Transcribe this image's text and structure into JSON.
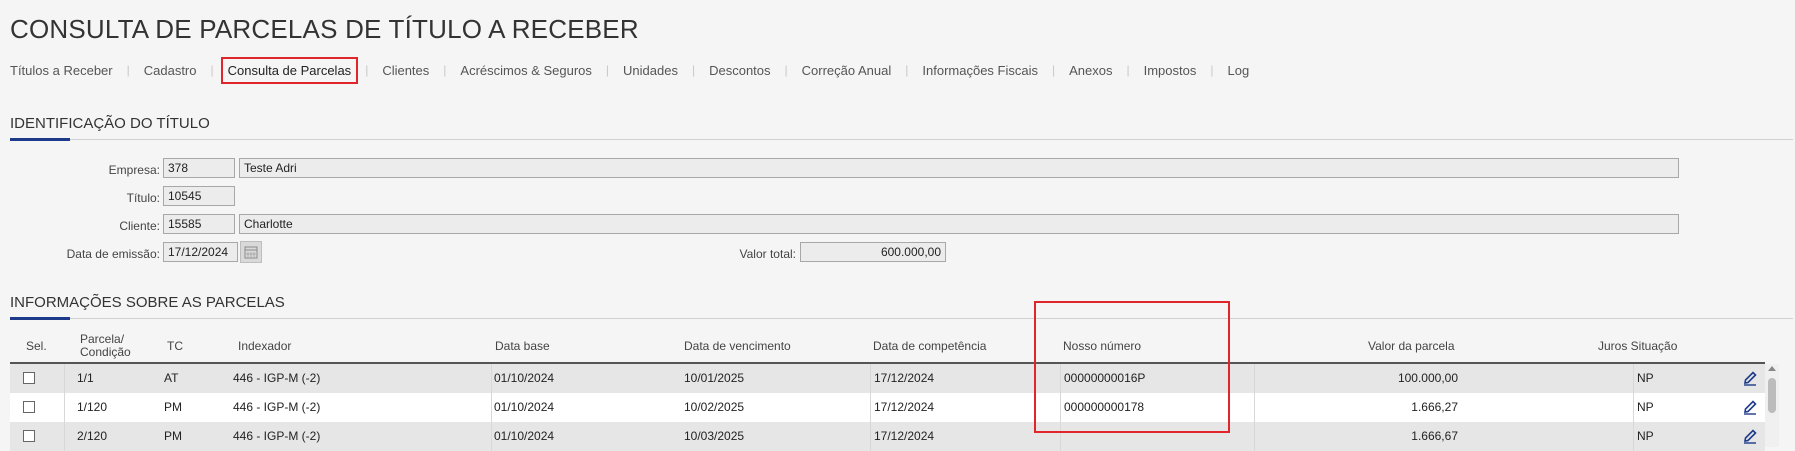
{
  "page_title": "CONSULTA DE PARCELAS DE TÍTULO A RECEBER",
  "tabs": [
    {
      "label": "Títulos a Receber"
    },
    {
      "label": "Cadastro"
    },
    {
      "label": "Consulta de Parcelas",
      "active": true
    },
    {
      "label": "Clientes"
    },
    {
      "label": "Acréscimos & Seguros"
    },
    {
      "label": "Unidades"
    },
    {
      "label": "Descontos"
    },
    {
      "label": "Correção Anual"
    },
    {
      "label": "Informações Fiscais"
    },
    {
      "label": "Anexos"
    },
    {
      "label": "Impostos"
    },
    {
      "label": "Log"
    }
  ],
  "identificacao": {
    "title": "IDENTIFICAÇÃO DO TÍTULO",
    "empresa_label": "Empresa:",
    "empresa_code": "378",
    "empresa_name": "Teste Adri",
    "titulo_label": "Título:",
    "titulo_value": "10545",
    "cliente_label": "Cliente:",
    "cliente_code": "15585",
    "cliente_name": "Charlotte",
    "data_emissao_label": "Data de emissão:",
    "data_emissao_value": "17/12/2024",
    "valor_total_label": "Valor total:",
    "valor_total_value": "600.000,00"
  },
  "parcelas": {
    "title": "INFORMAÇÕES SOBRE AS PARCELAS",
    "headers": {
      "sel": "Sel.",
      "parcela_line1": "Parcela/",
      "parcela_line2": "Condição",
      "tc": "TC",
      "indexador": "Indexador",
      "data_base": "Data base",
      "data_vencimento": "Data de vencimento",
      "data_competencia": "Data de competência",
      "nosso_numero": "Nosso número",
      "valor_parcela": "Valor da parcela",
      "juros_situacao": "Juros Situação"
    },
    "rows": [
      {
        "parcela": "1/1",
        "tc": "AT",
        "indexador": "446 - IGP-M (-2)",
        "data_base": "01/10/2024",
        "vencimento": "10/01/2025",
        "competencia": "17/12/2024",
        "nosso_numero": "00000000016P",
        "valor": "100.000,00",
        "situacao": "NP"
      },
      {
        "parcela": "1/120",
        "tc": "PM",
        "indexador": "446 - IGP-M (-2)",
        "data_base": "01/10/2024",
        "vencimento": "10/02/2025",
        "competencia": "17/12/2024",
        "nosso_numero": "000000000178",
        "valor": "1.666,27",
        "situacao": "NP"
      },
      {
        "parcela": "2/120",
        "tc": "PM",
        "indexador": "446 - IGP-M (-2)",
        "data_base": "01/10/2024",
        "vencimento": "10/03/2025",
        "competencia": "17/12/2024",
        "nosso_numero": "",
        "valor": "1.666,67",
        "situacao": "NP"
      }
    ]
  },
  "colors": {
    "highlight": "#e0262b",
    "accent": "#1e3a8a",
    "edit_icon": "#1e3a8a"
  },
  "icons": [
    "calendar-icon",
    "edit-pencil-icon",
    "checkbox"
  ]
}
